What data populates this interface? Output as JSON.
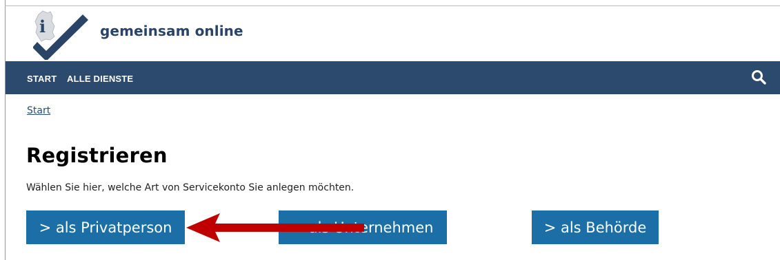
{
  "header": {
    "brand": "gemeinsam online"
  },
  "nav": {
    "items": [
      {
        "label": "START"
      },
      {
        "label": "ALLE DIENSTE"
      }
    ],
    "search_icon": "search-icon"
  },
  "breadcrumb": {
    "label": "Start"
  },
  "main": {
    "title": "Registrieren",
    "intro": "Wählen Sie hier, welche Art von Servicekonto Sie anlegen möchten.",
    "buttons": [
      {
        "label": "> als Privatperson"
      },
      {
        "label": "> als Unternehmen"
      },
      {
        "label": "> als Behörde"
      }
    ]
  },
  "colors": {
    "nav_background": "#2c4a6e",
    "button_background": "#1b6fa6",
    "brand_text": "#2a4468",
    "arrow": "#c00000"
  }
}
